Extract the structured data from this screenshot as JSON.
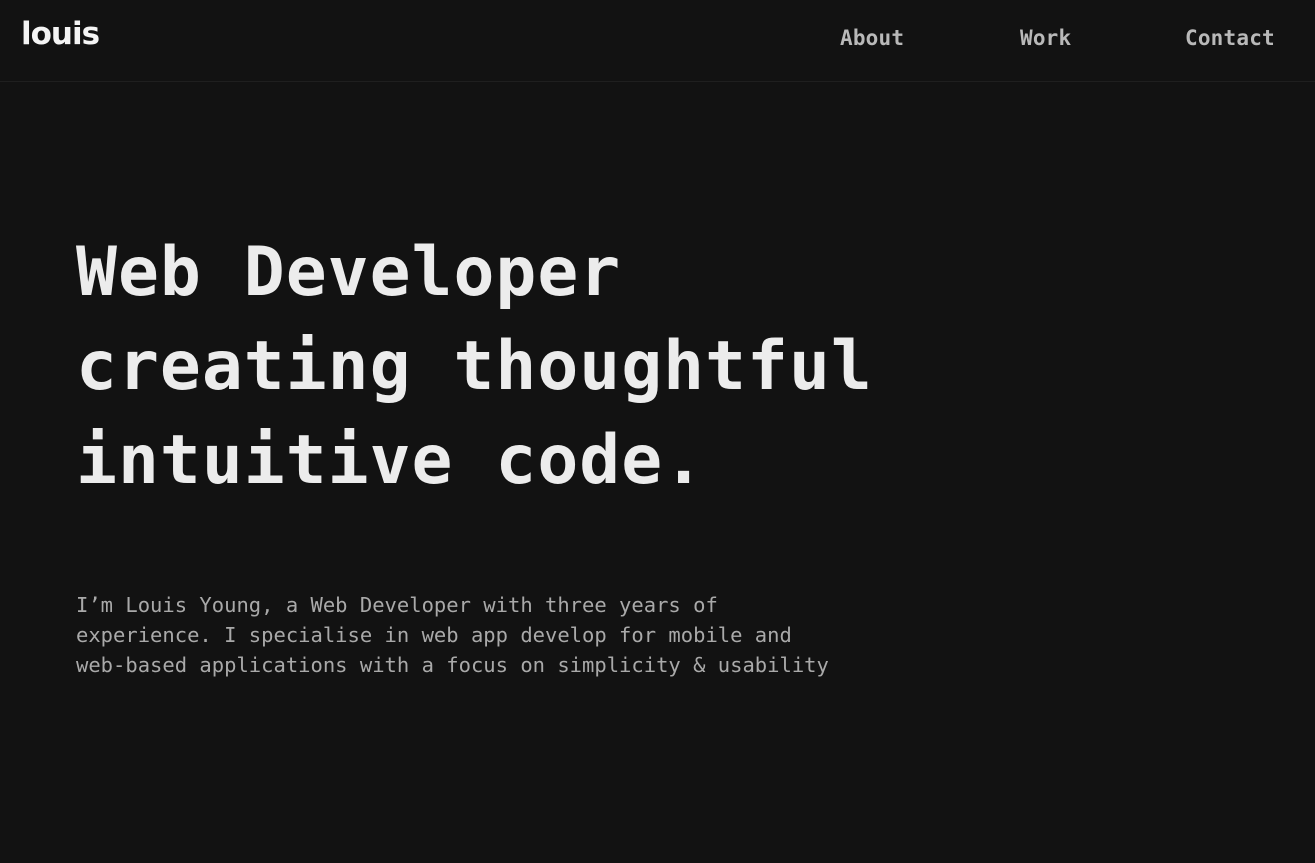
{
  "header": {
    "logo": "louis",
    "nav": [
      {
        "label": "About"
      },
      {
        "label": "Work"
      },
      {
        "label": "Contact"
      }
    ]
  },
  "hero": {
    "headline_lines": [
      "Web Developer",
      "creating thoughtful",
      "intuitive code."
    ],
    "intro_lines": [
      "I’m Louis Young, a Web Developer with three years of",
      "experience. I specialise in web app develop for mobile and",
      "web-based applications with a focus on simplicity & usability"
    ]
  },
  "colors": {
    "background": "#121212",
    "headline": "#ececec",
    "nav_text": "#b9b9b9",
    "body_text": "#a9a9a9"
  }
}
